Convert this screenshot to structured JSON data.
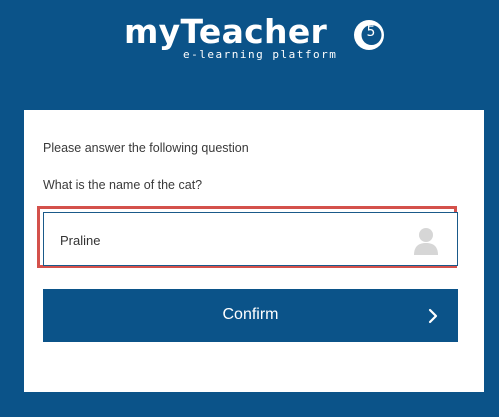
{
  "header": {
    "logo_text": "myTeacher",
    "version_badge": "5",
    "tagline": "e-learning platform"
  },
  "form": {
    "prompt": "Please answer the following question",
    "question": "What is the name of the cat?",
    "answer_value": "Praline",
    "answer_icon": "user-icon",
    "confirm_label": "Confirm",
    "confirm_icon": "chevron-right-icon"
  },
  "colors": {
    "background": "#0b5389",
    "card": "#ffffff",
    "highlight_border": "#d4514b",
    "button": "#0b5389"
  }
}
